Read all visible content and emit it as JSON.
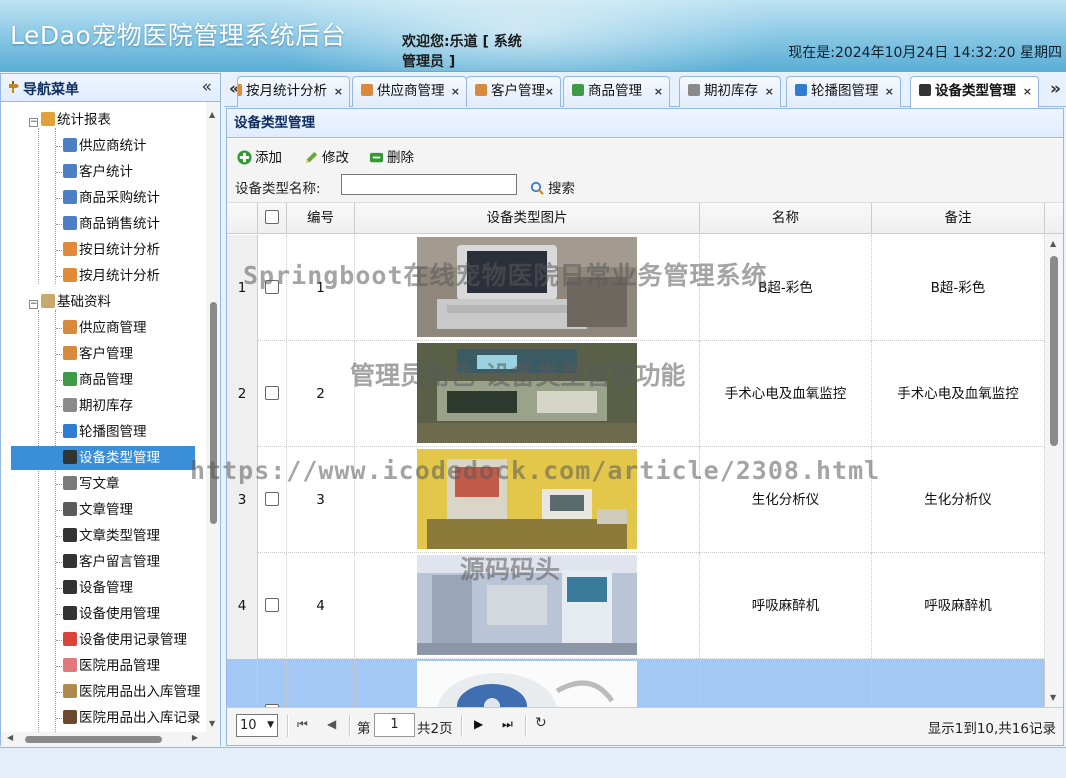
{
  "header": {
    "app_title": "LeDao宠物医院管理系统后台",
    "welcome": "欢迎您:乐道 [ 系统管理员 ]",
    "datetime": "现在是:2024年10月24日 14:32:20 星期四"
  },
  "nav": {
    "title": "导航菜单",
    "items": [
      {
        "label": "统计报表",
        "icon": "chart-folder-icon"
      },
      {
        "label": "供应商统计",
        "icon": "bar-chart-icon"
      },
      {
        "label": "客户统计",
        "icon": "bar-chart-icon"
      },
      {
        "label": "商品采购统计",
        "icon": "bar-chart-icon"
      },
      {
        "label": "商品销售统计",
        "icon": "bar-chart-icon"
      },
      {
        "label": "按日统计分析",
        "icon": "column-chart-icon"
      },
      {
        "label": "按月统计分析",
        "icon": "column-chart-icon"
      },
      {
        "label": "基础资料",
        "icon": "folder-icon"
      },
      {
        "label": "供应商管理",
        "icon": "user-icon"
      },
      {
        "label": "客户管理",
        "icon": "user-icon"
      },
      {
        "label": "商品管理",
        "icon": "sitemap-icon"
      },
      {
        "label": "期初库存",
        "icon": "database-icon"
      },
      {
        "label": "轮播图管理",
        "icon": "slides-icon"
      },
      {
        "label": "设备类型管理",
        "icon": "chip-icon"
      },
      {
        "label": "写文章",
        "icon": "pen-icon"
      },
      {
        "label": "文章管理",
        "icon": "document-icon"
      },
      {
        "label": "文章类型管理",
        "icon": "crop-icon"
      },
      {
        "label": "客户留言管理",
        "icon": "comment-icon"
      },
      {
        "label": "设备管理",
        "icon": "expand-icon"
      },
      {
        "label": "设备使用管理",
        "icon": "tree-icon"
      },
      {
        "label": "设备使用记录管理",
        "icon": "transfer-icon"
      },
      {
        "label": "医院用品管理",
        "icon": "flask-icon"
      },
      {
        "label": "医院用品出入库管理",
        "icon": "box-icon"
      },
      {
        "label": "医院用品出入库记录",
        "icon": "house-icon"
      }
    ]
  },
  "tabs": [
    {
      "label": "按月统计分析",
      "icon": "column-chart-icon"
    },
    {
      "label": "供应商管理",
      "icon": "user-icon"
    },
    {
      "label": "客户管理",
      "icon": "user-icon"
    },
    {
      "label": "商品管理",
      "icon": "sitemap-icon"
    },
    {
      "label": "期初库存",
      "icon": "database-icon"
    },
    {
      "label": "轮播图管理",
      "icon": "slides-icon"
    },
    {
      "label": "设备类型管理",
      "icon": "chip-icon"
    }
  ],
  "panel": {
    "title": "设备类型管理",
    "toolbar": {
      "add": "添加",
      "edit": "修改",
      "delete": "删除"
    },
    "search_label": "设备类型名称:",
    "search_value": "",
    "search_button": "搜索"
  },
  "grid": {
    "columns": [
      "编号",
      "设备类型图片",
      "名称",
      "备注"
    ],
    "rows": [
      {
        "rownum": "1",
        "id": "1",
        "image": "ultrasound-machine",
        "name": "B超-彩色",
        "remark": "B超-彩色"
      },
      {
        "rownum": "2",
        "id": "2",
        "image": "ecg-oxygen-monitor",
        "name": "手术心电及血氧监控",
        "remark": "手术心电及血氧监控"
      },
      {
        "rownum": "3",
        "id": "3",
        "image": "biochemical-analyzer",
        "name": "生化分析仪",
        "remark": "生化分析仪"
      },
      {
        "rownum": "4",
        "id": "4",
        "image": "anesthesia-machine",
        "name": "呼吸麻醉机",
        "remark": "呼吸麻醉机"
      },
      {
        "rownum": "",
        "id": "",
        "image": "dental-scaler",
        "name": "",
        "remark": ""
      }
    ]
  },
  "pager": {
    "page_size": "10",
    "page_label_before": "第",
    "page_number": "1",
    "page_label_after": "共2页",
    "summary": "显示1到10,共16记录"
  },
  "watermarks": [
    "Springboot在线宠物医院日常业务管理系统",
    "管理员角色-设备类型管理功能",
    "https://www.icodedock.com/article/2308.html",
    "源码码头"
  ],
  "colors": {
    "accent": "#3b8ed8",
    "border": "#95b8e7",
    "selected_row": "#a4c8f5"
  }
}
